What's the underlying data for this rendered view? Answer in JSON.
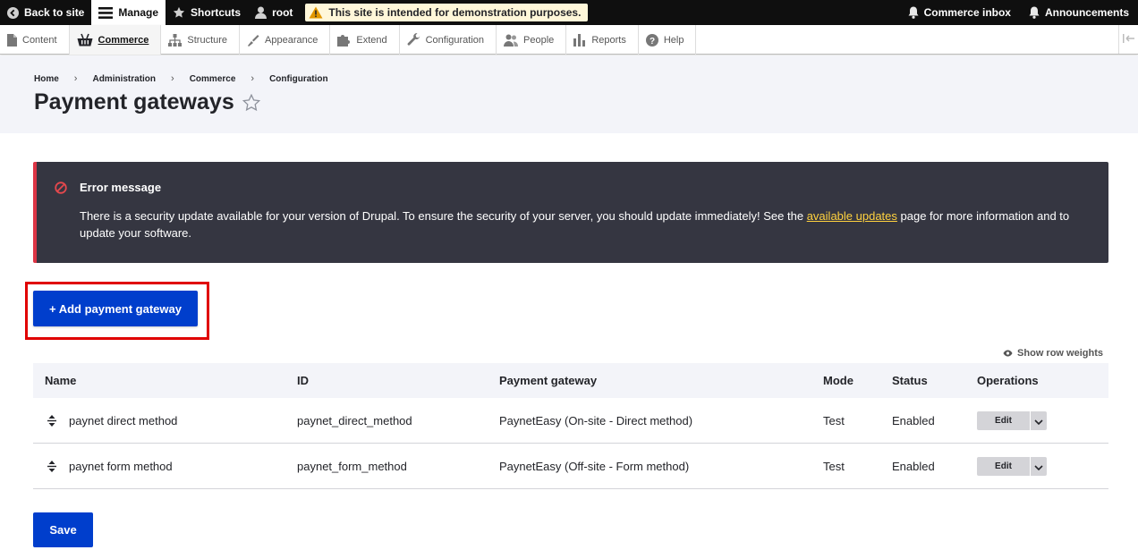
{
  "toolbar": {
    "back_to_site": "Back to site",
    "manage": "Manage",
    "shortcuts": "Shortcuts",
    "user": "root",
    "warning": "This site is intended for demonstration purposes.",
    "commerce_inbox": "Commerce inbox",
    "announcements": "Announcements"
  },
  "tray": {
    "items": [
      {
        "label": "Content"
      },
      {
        "label": "Commerce"
      },
      {
        "label": "Structure"
      },
      {
        "label": "Appearance"
      },
      {
        "label": "Extend"
      },
      {
        "label": "Configuration"
      },
      {
        "label": "People"
      },
      {
        "label": "Reports"
      },
      {
        "label": "Help"
      }
    ]
  },
  "breadcrumb": [
    "Home",
    "Administration",
    "Commerce",
    "Configuration"
  ],
  "page_title": "Payment gateways",
  "error": {
    "title": "Error message",
    "body_before": "There is a security update available for your version of Drupal. To ensure the security of your server, you should update immediately! See the ",
    "link": "available updates",
    "body_after": " page for more information and to update your software."
  },
  "add_button": "+ Add payment gateway",
  "show_row_weights": "Show row weights",
  "table": {
    "headers": {
      "name": "Name",
      "id": "ID",
      "gateway": "Payment gateway",
      "mode": "Mode",
      "status": "Status",
      "operations": "Operations"
    },
    "rows": [
      {
        "name": "paynet direct method",
        "id": "paynet_direct_method",
        "gateway": "PaynetEasy (On-site - Direct method)",
        "mode": "Test",
        "status": "Enabled",
        "op": "Edit"
      },
      {
        "name": "paynet form method",
        "id": "paynet_form_method",
        "gateway": "PaynetEasy (Off-site - Form method)",
        "mode": "Test",
        "status": "Enabled",
        "op": "Edit"
      }
    ]
  },
  "save_button": "Save",
  "colors": {
    "primary_button": "#003ecc",
    "error_bg": "#353641",
    "error_accent": "#dc3545",
    "link_yellow": "#ffd23f",
    "highlight_red": "#e00000"
  }
}
